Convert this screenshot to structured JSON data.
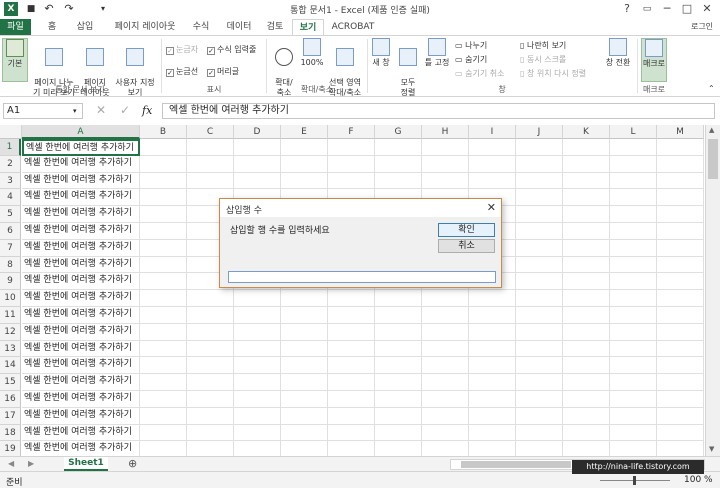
{
  "titlebar": {
    "title": "통합 문서1 - Excel (제품 인증 실패)",
    "qa_excel": "X",
    "qa_save": "💾",
    "qa_undo": "↶",
    "qa_redo": "↷",
    "help": "?",
    "restore": "▭",
    "min": "─",
    "max": "□",
    "close": "✕",
    "user": "로그인"
  },
  "tabs": [
    "파일",
    "홈",
    "삽입",
    "페이지 레이아웃",
    "수식",
    "데이터",
    "검토",
    "보기",
    "ACROBAT"
  ],
  "active_tab": "보기",
  "ribbon": {
    "view_buttons": [
      {
        "label": "기본"
      },
      {
        "label": "페이지 나누\n기 미리 보기"
      },
      {
        "label": "페이지\n레이아웃"
      },
      {
        "label": "사용자 지정\n보기"
      }
    ],
    "group_views": "통합 문서 보기",
    "show_checks": [
      {
        "label": "눈금자",
        "checked": true,
        "disabled": true
      },
      {
        "label": "수식 입력줄",
        "checked": true,
        "disabled": false
      },
      {
        "label": "눈금선",
        "checked": true,
        "disabled": false
      },
      {
        "label": "머리글",
        "checked": true,
        "disabled": false
      }
    ],
    "group_show": "표시",
    "zoom_buttons": [
      {
        "label": "확대/\n축소"
      },
      {
        "label": "100%"
      },
      {
        "label": "선택 영역\n확대/축소"
      }
    ],
    "group_zoom": "확대/축소",
    "window_buttons": [
      {
        "label": "새 창"
      },
      {
        "label": "모두\n정렬"
      },
      {
        "label": "틀 고정"
      }
    ],
    "window_small": [
      {
        "label": "나누기",
        "disabled": false
      },
      {
        "label": "숨기기",
        "disabled": false
      },
      {
        "label": "숨기기 취소",
        "disabled": true
      },
      {
        "label": "나란히 보기",
        "disabled": false
      },
      {
        "label": "동시 스크롤",
        "disabled": true
      },
      {
        "label": "창 위치 다시 정렬",
        "disabled": true
      }
    ],
    "switch_window": "창 전환",
    "group_window": "창",
    "macro": "매크로",
    "group_macro": "매크로"
  },
  "formula_bar": {
    "name_box": "A1",
    "cancel": "✕",
    "enter": "✓",
    "fx": "fx",
    "formula": "엑셀 한번에 여러행 추가하기"
  },
  "grid": {
    "columns": [
      "A",
      "B",
      "C",
      "D",
      "E",
      "F",
      "G",
      "H",
      "I",
      "J",
      "K",
      "L",
      "M"
    ],
    "rows": [
      "1",
      "2",
      "3",
      "4",
      "5",
      "6",
      "7",
      "8",
      "9",
      "10",
      "11",
      "12",
      "13",
      "14",
      "15",
      "16",
      "17",
      "18",
      "19"
    ],
    "cell_text": "엑셀 한번에 여러행 추가하기"
  },
  "dialog": {
    "title": "삽입행 수",
    "prompt": "삽입할 행 수를 입력하세요",
    "ok": "확인",
    "cancel": "취소",
    "close": "✕",
    "input_value": ""
  },
  "sheets": {
    "tabs": [
      "Sheet1"
    ],
    "add": "⊕",
    "prev": "◀",
    "next": "▶"
  },
  "status": {
    "ready": "준비",
    "zoom": "100 %",
    "watermark": "http://nina-life.tistory.com"
  },
  "colors": {
    "accent": "#217346",
    "dialog_border": "#c68a4a"
  }
}
